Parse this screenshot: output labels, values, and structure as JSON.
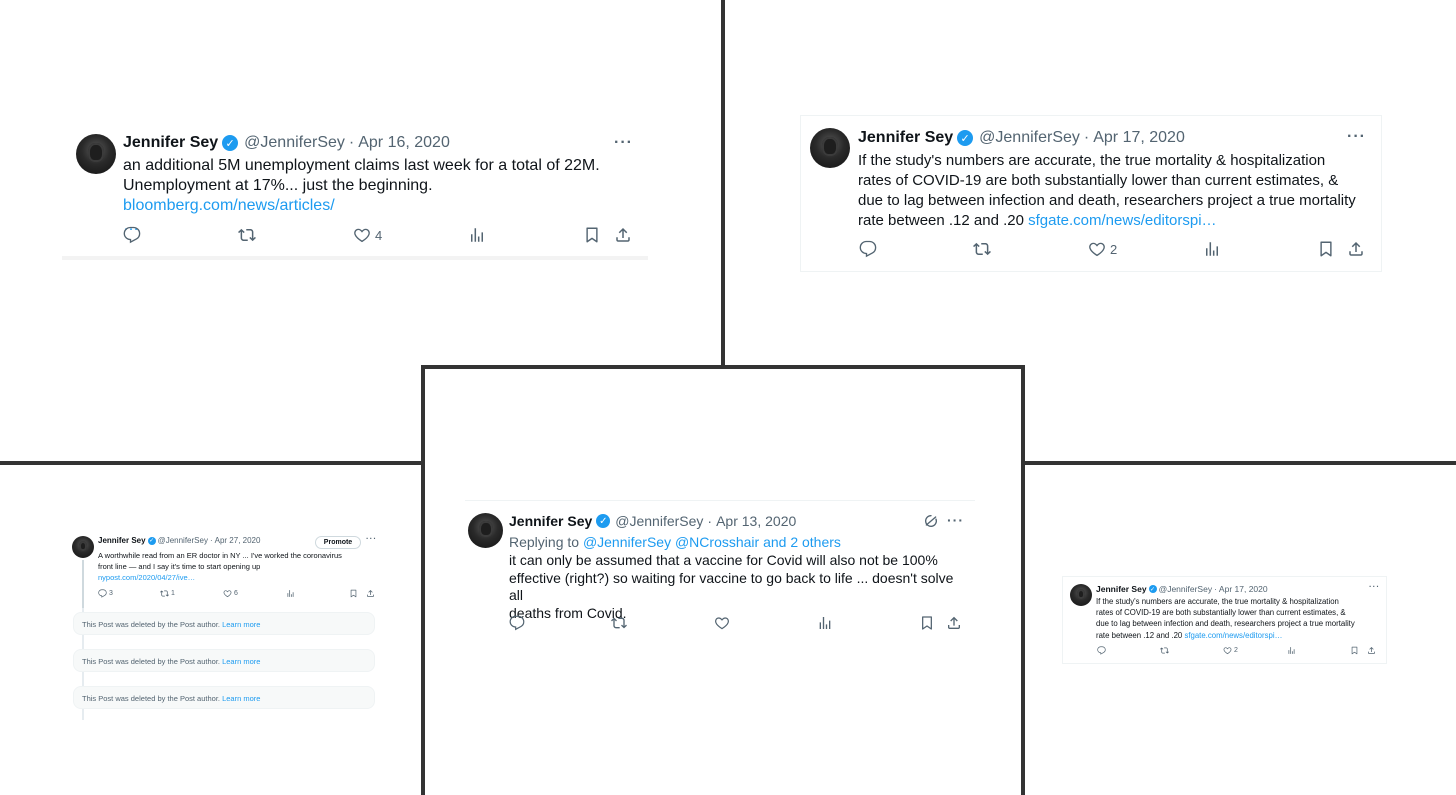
{
  "author": {
    "name": "Jennifer Sey",
    "handle": "@JenniferSey"
  },
  "colors": {
    "link": "#1d9bf0",
    "muted": "#536471",
    "text": "#0f1419",
    "divider": "#333333"
  },
  "icons": [
    "reply-icon",
    "retweet-icon",
    "like-icon",
    "views-icon",
    "bookmark-icon",
    "share-icon",
    "more-icon",
    "verified-badge-icon",
    "grok-icon"
  ],
  "tweet1": {
    "date": "Apr 16, 2020",
    "line1": "an additional 5M unemployment claims last week for a total of 22M.",
    "line2": "Unemployment at 17%... just the beginning.",
    "link": "bloomberg.com/news/articles/",
    "ellipsis": "…",
    "likes": "4"
  },
  "tweet2": {
    "date": "Apr 17, 2020",
    "line1": "If the study's numbers are accurate, the true mortality & hospitalization",
    "line2": "rates of COVID-19 are both substantially lower than current estimates, &",
    "line3": "due to lag between infection and death, researchers project a true mortality",
    "line4": "rate between .12 and .20",
    "link": "sfgate.com/news/editorspi…",
    "likes": "2"
  },
  "tweet3": {
    "date": "Apr 27, 2020",
    "promote": "Promote",
    "line1": "A worthwhile read from an ER doctor in NY ... I've worked the coronavirus",
    "line2": "front line — and I say it's time to start opening up",
    "link": "nypost.com/2020/04/27/ive…",
    "replies": "3",
    "reposts": "1",
    "likes": "6",
    "deleted_text": "This Post was deleted by the Post author.",
    "learn_more": "Learn more"
  },
  "tweet4": {
    "date": "Apr 13, 2020",
    "replying_to": "Replying to",
    "mentions": "@JenniferSey @NCrosshair and 2 others",
    "line1": "it can only be assumed that a vaccine for Covid will also not be 100%",
    "line2": "effective (right?) so waiting for vaccine to go back to life ... doesn't solve all",
    "line3": "deaths from Covid."
  },
  "tweet5": {
    "date": "Apr 17, 2020",
    "line1": "If the study's numbers are accurate, the true mortality & hospitalization",
    "line2": "rates of COVID-19 are both substantially lower than current estimates, &",
    "line3": "due to lag between infection and death, researchers project a true mortality",
    "line4": "rate between .12 and .20",
    "link": "sfgate.com/news/editorspi…",
    "likes": "2"
  }
}
